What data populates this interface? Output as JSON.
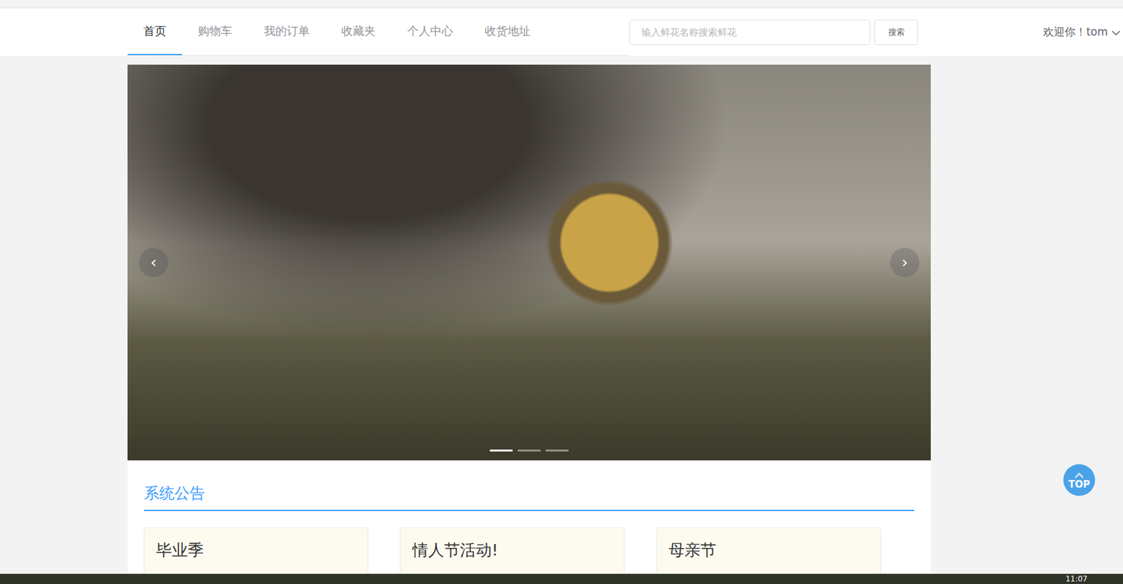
{
  "nav": {
    "tabs": [
      {
        "label": "首页",
        "selected": true
      },
      {
        "label": "购物车",
        "selected": false
      },
      {
        "label": "我的订单",
        "selected": false
      },
      {
        "label": "收藏夹",
        "selected": false
      },
      {
        "label": "个人中心",
        "selected": false
      },
      {
        "label": "收货地址",
        "selected": false
      }
    ]
  },
  "search": {
    "placeholder": "输入鲜花名称搜索鲜花",
    "button": "搜索"
  },
  "user": {
    "greeting": "欢迎你！tom"
  },
  "carousel": {
    "prev": "‹",
    "next": "›",
    "indicators": [
      {
        "selected": true
      },
      {
        "selected": false
      },
      {
        "selected": false
      }
    ]
  },
  "notices": {
    "title": "系统公告",
    "items": [
      {
        "title": "毕业季"
      },
      {
        "title": "情人节活动!"
      },
      {
        "title": "母亲节"
      }
    ]
  },
  "back_to_top": {
    "label": "TOP"
  },
  "taskbar": {
    "clock": "11:07"
  }
}
